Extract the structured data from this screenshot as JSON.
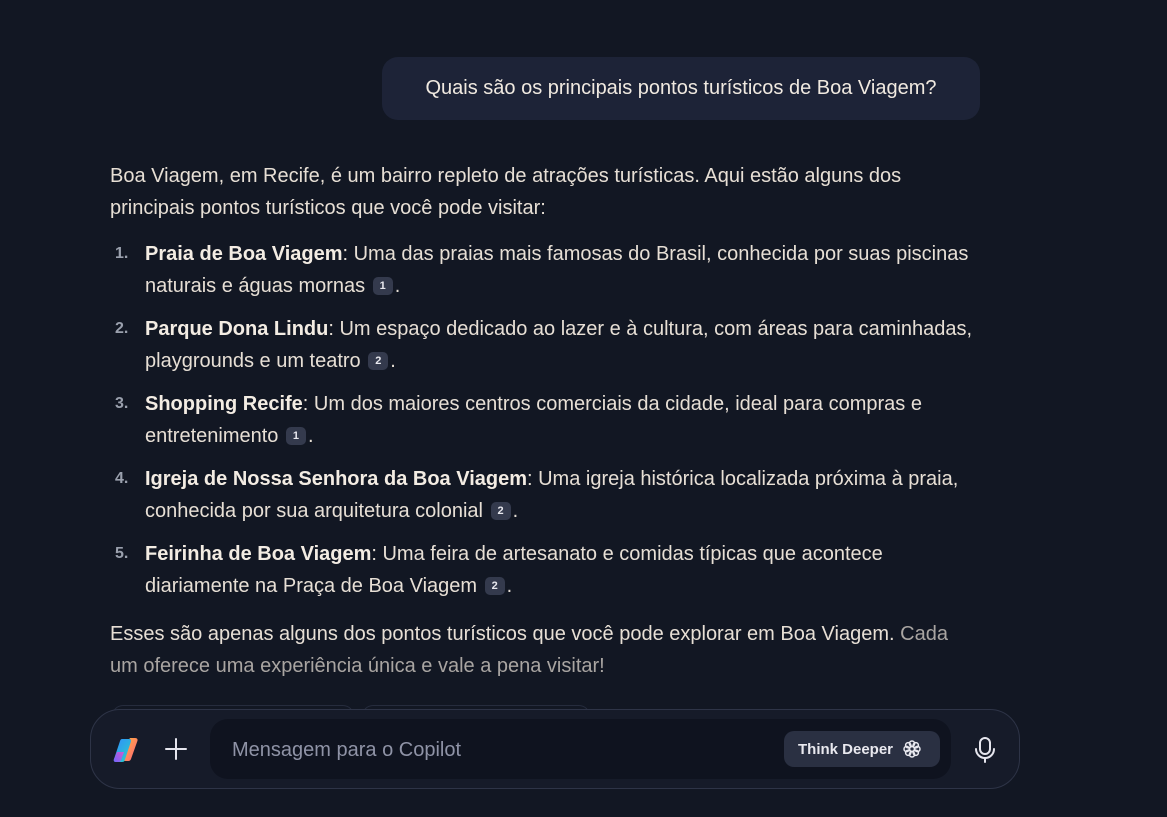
{
  "conversation": {
    "user_message": "Quais são os principais pontos turísticos de Boa Viagem?",
    "assistant": {
      "intro": "Boa Viagem, em Recife, é um bairro repleto de atrações turísticas. Aqui estão alguns dos principais pontos turísticos que você pode visitar:",
      "items": [
        {
          "number": "1.",
          "term": "Praia de Boa Viagem",
          "text": ": Uma das praias mais famosas do Brasil, conhecida por suas piscinas naturais e águas mornas",
          "citation": "1",
          "end": "."
        },
        {
          "number": "2.",
          "term": "Parque Dona Lindu",
          "text": ": Um espaço dedicado ao lazer e à cultura, com áreas para caminhadas, playgrounds e um teatro",
          "citation": "2",
          "end": "."
        },
        {
          "number": "3.",
          "term": "Shopping Recife",
          "text": ": Um dos maiores centros comerciais da cidade, ideal para compras e entretenimento",
          "citation": "1",
          "end": "."
        },
        {
          "number": "4.",
          "term": "Igreja de Nossa Senhora da Boa Viagem",
          "text": ": Uma igreja histórica localizada próxima à praia, conhecida por sua arquitetura colonial",
          "citation": "2",
          "end": "."
        },
        {
          "number": "5.",
          "term": "Feirinha de Boa Viagem",
          "text": ": Uma feira de artesanato e comidas típicas que acontece diariamente na Praça de Boa Viagem",
          "citation": "2",
          "end": "."
        }
      ],
      "outro_main": "Esses são apenas alguns dos pontos turísticos que você pode explorar em Boa Viagem.",
      "outro_faded": "Cada um oferece uma experiência única e vale a pena visitar!"
    }
  },
  "composer": {
    "placeholder": "Mensagem para o Copilot",
    "value": "",
    "think_deeper_label": "Think Deeper",
    "icons": {
      "logo": "copilot-logo-icon",
      "add": "plus-icon",
      "think": "think-deeper-icon",
      "mic": "microphone-icon"
    }
  },
  "colors": {
    "background": "#121723",
    "user_bubble": "#1d2337",
    "text": "#e7dfd5",
    "composer_bg": "#161b29",
    "input_bg": "#0f131f",
    "citation_bg": "#343a4d"
  }
}
